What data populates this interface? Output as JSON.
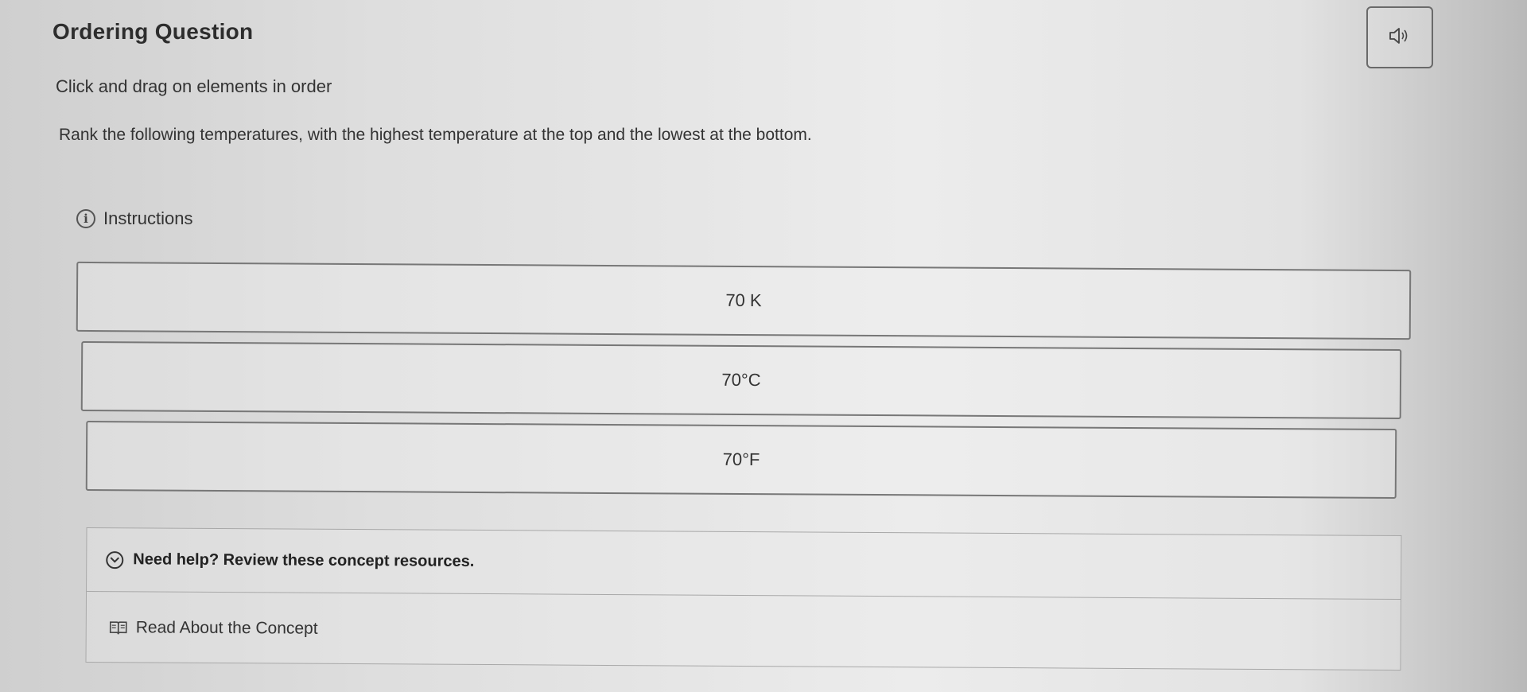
{
  "header": {
    "title": "Ordering Question",
    "audio_icon": "speaker-icon"
  },
  "subtitle": "Click and drag on elements in order",
  "prompt": "Rank the following temperatures, with the highest temperature at the top and the lowest at the bottom.",
  "instructions": {
    "label": "Instructions",
    "icon": "info-icon"
  },
  "items": [
    {
      "label": "70 K"
    },
    {
      "label": "70°C"
    },
    {
      "label": "70°F"
    }
  ],
  "help": {
    "header": "Need help? Review these concept resources.",
    "header_icon": "chevron-down-icon",
    "links": [
      {
        "label": "Read About the Concept",
        "icon": "book-icon"
      }
    ]
  }
}
